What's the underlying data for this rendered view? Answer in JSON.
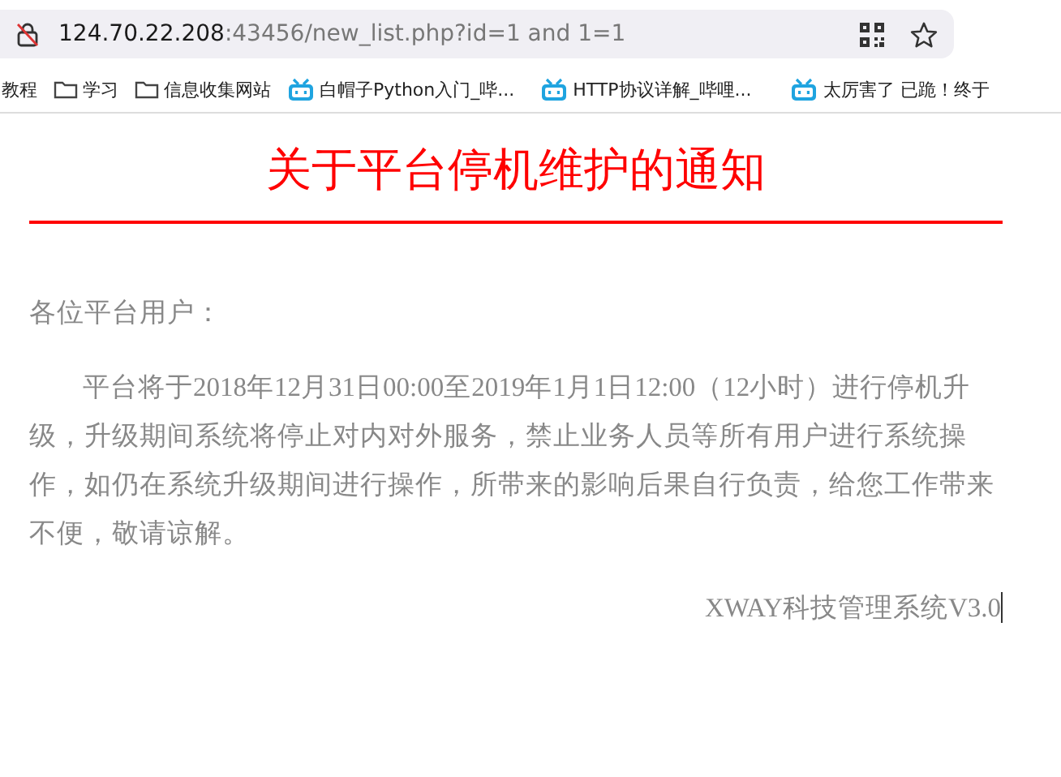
{
  "address_bar": {
    "host": "124.70.22.208",
    "rest": ":43456/new_list.php?id=1 and 1=1"
  },
  "bookmarks": [
    {
      "kind": "plain",
      "label": "教程"
    },
    {
      "kind": "folder",
      "label": "学习"
    },
    {
      "kind": "folder",
      "label": "信息收集网站"
    },
    {
      "kind": "tv",
      "label": "白帽子Python入门_哔..."
    },
    {
      "kind": "tv",
      "label": "HTTP协议详解_哔哩..."
    },
    {
      "kind": "tv",
      "label": "太厉害了 已跪！终于"
    }
  ],
  "notice": {
    "title": "关于平台停机维护的通知",
    "greeting": "各位平台用户：",
    "body": "平台将于2018年12月31日00:00至2019年1月1日12:00（12小时）进行停机升级，升级期间系统将停止对内对外服务，禁止业务人员等所有用户进行系统操作，如仍在系统升级期间进行操作，所带来的影响后果自行负责，给您工作带来不便，敬请谅解。",
    "signature": "XWAY科技管理系统V3.0"
  }
}
